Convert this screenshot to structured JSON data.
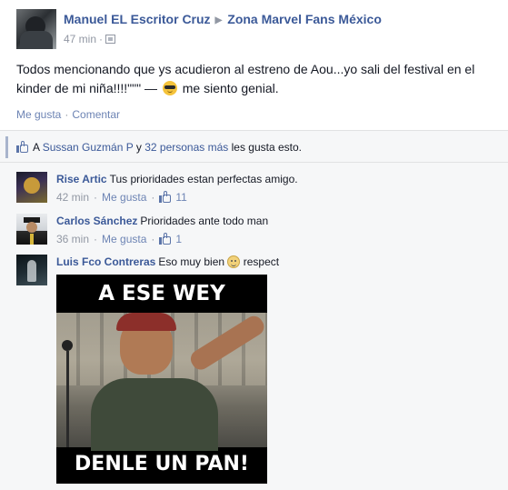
{
  "post": {
    "author": "Manuel EL Escritor Cruz",
    "target_page": "Zona Marvel Fans México",
    "time": "47 min",
    "meta_separator": "·",
    "body_main": "Todos mencionando que ys acudieron al estreno de Aou...yo sali del festival en el kinder de mi niña!!!!\"\"\" —",
    "body_after_emoji": "me siento genial.",
    "emoji_icon": "sunglasses-emoji-icon"
  },
  "actions": {
    "like": "Me gusta",
    "separator": "·",
    "comment": "Comentar"
  },
  "likes": {
    "prefix": "A",
    "person": "Sussan Guzmán P",
    "connector": "y",
    "others": "32 personas más",
    "suffix": "les gusta esto."
  },
  "comments": [
    {
      "name": "Rise Artic",
      "text": "Tus prioridades estan perfectas amigo.",
      "time": "42 min",
      "like_label": "Me gusta",
      "like_count": "11"
    },
    {
      "name": "Carlos Sánchez",
      "text": "Prioridades ante todo man",
      "time": "36 min",
      "like_label": "Me gusta",
      "like_count": "1"
    },
    {
      "name": "Luis Fco Contreras",
      "text_before": "Eso muy bien",
      "text_after": "respect",
      "emoji_icon": "smile-emoji-icon",
      "meme": {
        "top_caption": "A ESE WEY",
        "bottom_caption": "DENLE UN PAN!"
      }
    }
  ],
  "colors": {
    "link": "#3b5998",
    "muted": "#9197a3",
    "ufi_background": "#f6f7f8"
  }
}
